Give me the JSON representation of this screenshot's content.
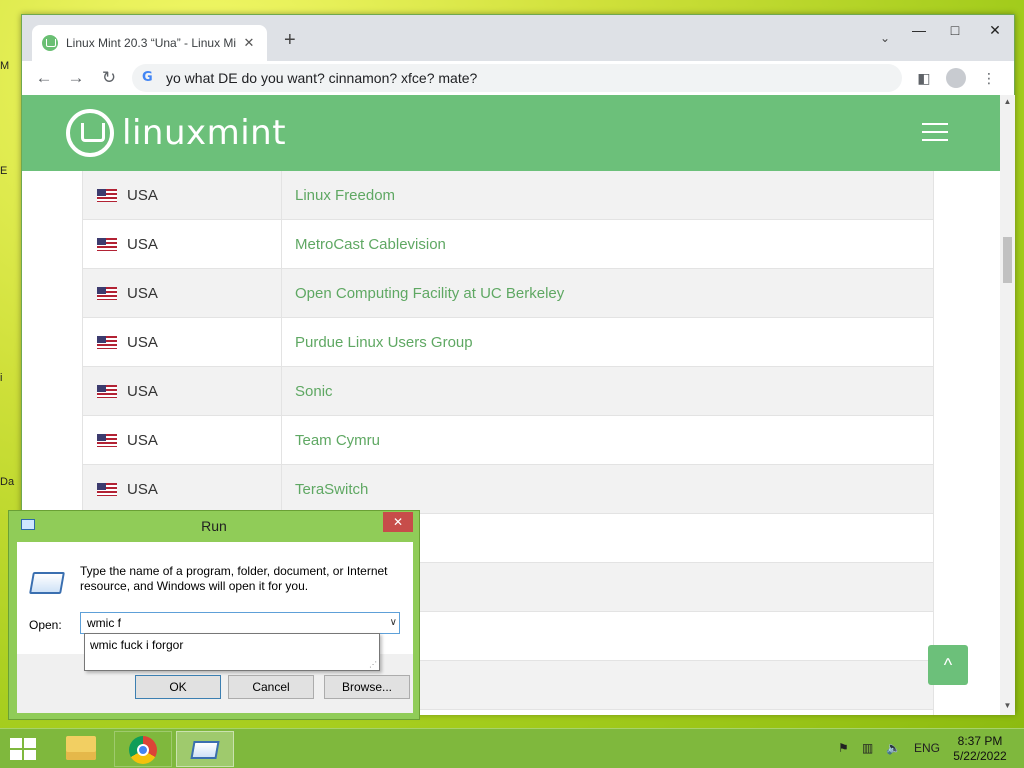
{
  "desktop": {
    "labels": [
      "M",
      "E",
      "i",
      "Da"
    ]
  },
  "browser": {
    "tab_title": "Linux Mint 20.3 “Una” - Linux Mi",
    "tab_close": "✕",
    "new_tab": "+",
    "tab_search": "⌄",
    "window_controls": {
      "minimize": "—",
      "maximize": "□",
      "close": "✕"
    },
    "nav": {
      "back": "←",
      "forward": "→",
      "reload": "↻"
    },
    "omnibox": {
      "google_g": "G",
      "value": "yo what DE do you want? cinnamon? xfce? mate?"
    },
    "toolbar_right": {
      "side_panel": "◧",
      "menu": "⋮"
    }
  },
  "site": {
    "logo_text": "linuxmint",
    "mirrors": [
      {
        "country": "USA",
        "name": "Linux Freedom"
      },
      {
        "country": "USA",
        "name": "MetroCast Cablevision"
      },
      {
        "country": "USA",
        "name": "Open Computing Facility at UC Berkeley"
      },
      {
        "country": "USA",
        "name": "Purdue Linux Users Group"
      },
      {
        "country": "USA",
        "name": "Sonic"
      },
      {
        "country": "USA",
        "name": "Team Cymru"
      },
      {
        "country": "USA",
        "name": "TeraSwitch"
      },
      {
        "country": "",
        "name": ""
      },
      {
        "country": "",
        "name": ""
      },
      {
        "country": "",
        "name": ""
      },
      {
        "country": "",
        "name": ""
      },
      {
        "country": "",
        "name": ""
      }
    ],
    "back_to_top": "^",
    "brand_color": "#6cc07a",
    "link_color": "#5fa863"
  },
  "scrollbar": {
    "up": "▲",
    "down": "▼"
  },
  "run_dialog": {
    "title": "Run",
    "close": "✕",
    "description": "Type the name of a program, folder, document, or Internet resource, and Windows will open it for you.",
    "open_label": "Open:",
    "input_value": "wmic f",
    "dropdown_arrow": "∨",
    "autocomplete": "wmic fuck i forgor",
    "buttons": {
      "ok": "OK",
      "cancel": "Cancel",
      "browse": "Browse..."
    }
  },
  "taskbar": {
    "language": "ENG",
    "time": "8:37 PM",
    "date": "5/22/2022",
    "tray_icons": [
      "flag-warning-icon",
      "network-icon",
      "volume-muted-icon"
    ]
  }
}
